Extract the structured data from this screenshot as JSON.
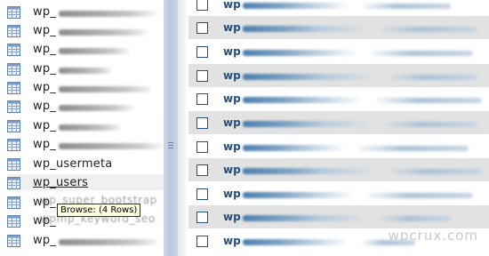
{
  "tree": {
    "items": [
      {
        "label": "wp_",
        "blurred": true
      },
      {
        "label": "wp_",
        "blurred": true
      },
      {
        "label": "wp_",
        "blurred": true
      },
      {
        "label": "wp_",
        "blurred": true
      },
      {
        "label": "wp_",
        "blurred": true
      },
      {
        "label": "wp_",
        "blurred": true
      },
      {
        "label": "wp_",
        "blurred": true
      },
      {
        "label": "wp_",
        "blurred": true
      },
      {
        "label": "wp_usermeta",
        "blurred": false
      },
      {
        "label": "wp_users",
        "blurred": false,
        "hovered": true
      },
      {
        "label": "wp_",
        "blurred": true,
        "ghost": "wp_super_bootstrap"
      },
      {
        "label": "wp_",
        "blurred": true,
        "ghost": "wpmp_keyword_seo"
      },
      {
        "label": "wp_",
        "blurred": true
      }
    ]
  },
  "tooltip": {
    "text": "Browse:  (4 Rows)"
  },
  "rows": [
    {
      "label": "wp",
      "alt": false
    },
    {
      "label": "wp",
      "alt": true
    },
    {
      "label": "wp",
      "alt": false
    },
    {
      "label": "wp",
      "alt": true
    },
    {
      "label": "wp",
      "alt": false
    },
    {
      "label": "wp",
      "alt": true
    },
    {
      "label": "wp",
      "alt": false
    },
    {
      "label": "wp",
      "alt": true
    },
    {
      "label": "wp",
      "alt": false
    },
    {
      "label": "wp",
      "alt": true
    },
    {
      "label": "wp",
      "alt": false
    }
  ],
  "watermark": "wpcrux.com",
  "colors": {
    "link": "#1f4d86",
    "row_alt": "#e2e2e2",
    "splitter": "#b7c8de"
  }
}
